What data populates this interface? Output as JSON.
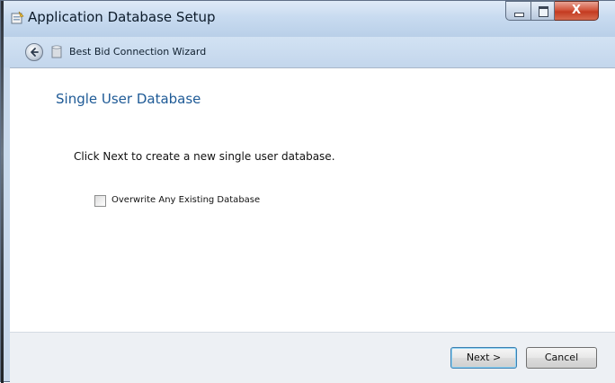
{
  "window": {
    "title": "Application Database Setup",
    "close_glyph": "X",
    "controls": [
      "minimize-icon",
      "maximize-icon",
      "close-icon"
    ],
    "title_icon": "setup-app-icon"
  },
  "navbar": {
    "back_icon": "back-arrow-icon",
    "wizard_icon": "database-icon",
    "wizard_title": "Best Bid Connection Wizard"
  },
  "page": {
    "heading": "Single User Database",
    "instruction": "Click Next to create a new single user database.",
    "overwrite_checkbox": {
      "label": "Overwrite Any Existing Database",
      "checked": false
    }
  },
  "footer": {
    "next_label": "Next >",
    "cancel_label": "Cancel"
  },
  "colors": {
    "heading": "#1e5a96",
    "close_button": "#c43a20",
    "next_button_border": "#3c7fb1"
  }
}
